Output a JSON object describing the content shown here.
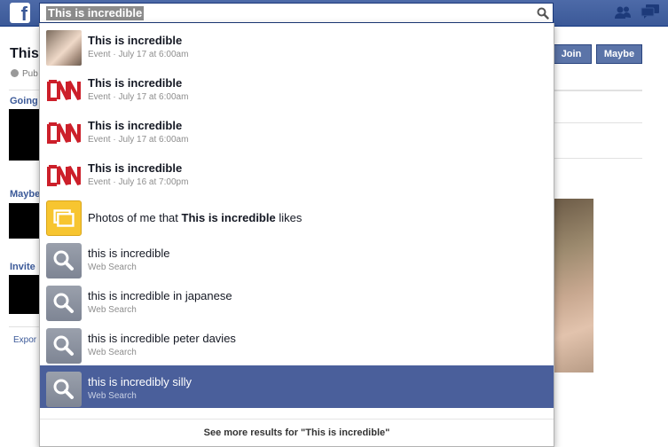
{
  "header": {
    "logo_letter": "f",
    "search_value": "This is incredible"
  },
  "event_page": {
    "title": "This",
    "privacy": "Pub",
    "going_label": "Going",
    "maybe_label": "Maybe",
    "invited_label": "Invite",
    "export_label": "Expor",
    "join_label": "Join",
    "maybe_button_label": "Maybe"
  },
  "dropdown": {
    "results": [
      {
        "type": "event",
        "thumb": "photo-thumbnail",
        "title": "This is incredible",
        "subtitle": "Event · July 17 at 6:00am"
      },
      {
        "type": "event",
        "thumb": "cnn-logo",
        "title": "This is incredible",
        "subtitle": "Event · July 17 at 6:00am"
      },
      {
        "type": "event",
        "thumb": "cnn-logo",
        "title": "This is incredible",
        "subtitle": "Event · July 17 at 6:00am"
      },
      {
        "type": "event",
        "thumb": "cnn-logo",
        "title": "This is incredible",
        "subtitle": "Event · July 16 at 7:00pm"
      },
      {
        "type": "photos",
        "thumb": "photos-icon",
        "title_prefix": "Photos of me that ",
        "title_bold": "This is incredible",
        "title_suffix": " likes"
      },
      {
        "type": "web",
        "thumb": "search-icon",
        "title": "this is incredible",
        "subtitle": "Web Search"
      },
      {
        "type": "web",
        "thumb": "search-icon",
        "title": "this is incredible in japanese",
        "subtitle": "Web Search"
      },
      {
        "type": "web",
        "thumb": "search-icon",
        "title": "this is incredible peter davies",
        "subtitle": "Web Search"
      },
      {
        "type": "web",
        "thumb": "search-icon",
        "title": "this is incredibly silly",
        "subtitle": "Web Search",
        "selected": true
      }
    ],
    "see_more": "See more results for \"This is incredible\""
  },
  "colors": {
    "topbar": "#3b5998",
    "selected_row": "#4a5f9b",
    "cnn_red": "#cc1f2a",
    "photos_yellow": "#f7c530"
  }
}
